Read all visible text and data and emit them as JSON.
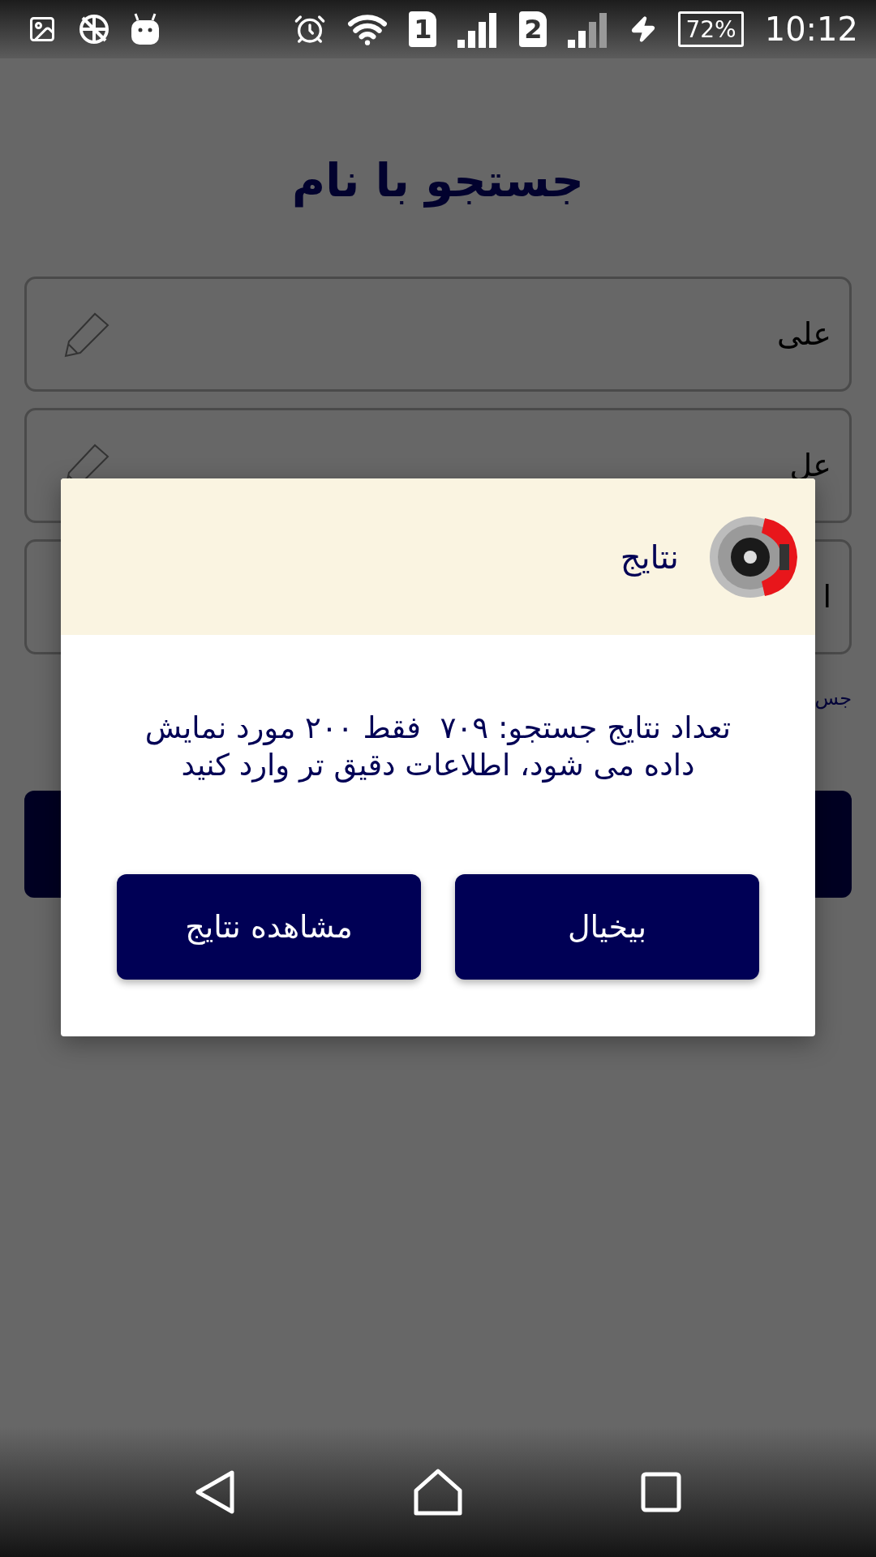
{
  "status_bar": {
    "sim_1": "1",
    "sim_2": "2",
    "battery": "72%",
    "time": "10:12"
  },
  "title": "جستجو با نام",
  "fields": [
    {
      "value": "علی"
    },
    {
      "value": "عل"
    },
    {
      "value": "ا"
    }
  ],
  "hint": "جس",
  "dialog": {
    "title": "نتایج",
    "message": "تعداد نتایج جستجو: ۷۰۹  فقط ۲۰۰ مورد نمایش داده می شود، اطلاعات دقیق تر وارد کنید",
    "buttons": [
      {
        "label": "بیخیال"
      },
      {
        "label": "مشاهده نتایج"
      }
    ]
  }
}
